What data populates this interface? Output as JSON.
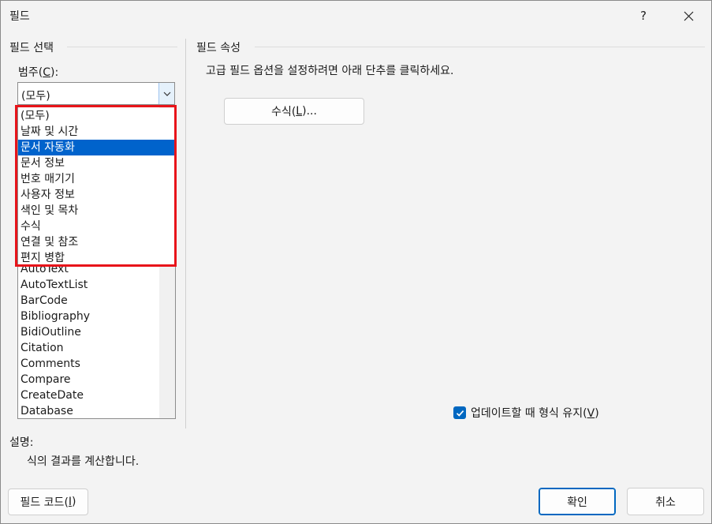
{
  "window": {
    "title": "필드",
    "help_label": "?",
    "close_icon": "close-icon"
  },
  "left": {
    "section_title": "필드 선택",
    "category_label": "범주(",
    "category_accel": "C",
    "category_label_end": "):",
    "combo_value": "(모두)",
    "dropdown_items": [
      "(모두)",
      "날짜 및 시간",
      "문서 자동화",
      "문서 정보",
      "번호 매기기",
      "사용자 정보",
      "색인 및 목차",
      "수식",
      "연결 및 참조",
      "편지 병합"
    ],
    "dropdown_selected_index": 2,
    "field_list": [
      "AutoText",
      "AutoTextList",
      "BarCode",
      "Bibliography",
      "BidiOutline",
      "Citation",
      "Comments",
      "Compare",
      "CreateDate",
      "Database"
    ],
    "highlight_color": "#e8141a"
  },
  "right": {
    "section_title": "필드 속성",
    "info_text": "고급 필드 옵션을 설정하려면 아래 단추를 클릭하세요.",
    "formula_button": {
      "pre": "수식(",
      "accel": "L",
      "post": ")..."
    },
    "checkbox": {
      "pre": "업데이트할 때 형식 유지(",
      "accel": "V",
      "post": ")",
      "checked": true
    }
  },
  "description": {
    "label": "설명:",
    "text": "식의 결과를 계산합니다."
  },
  "footer": {
    "field_codes_button": {
      "pre": "필드 코드(",
      "accel": "I",
      "post": ")"
    },
    "ok_button": "확인",
    "cancel_button": "취소"
  },
  "colors": {
    "accent": "#0067c0",
    "selection": "#0063cc"
  }
}
